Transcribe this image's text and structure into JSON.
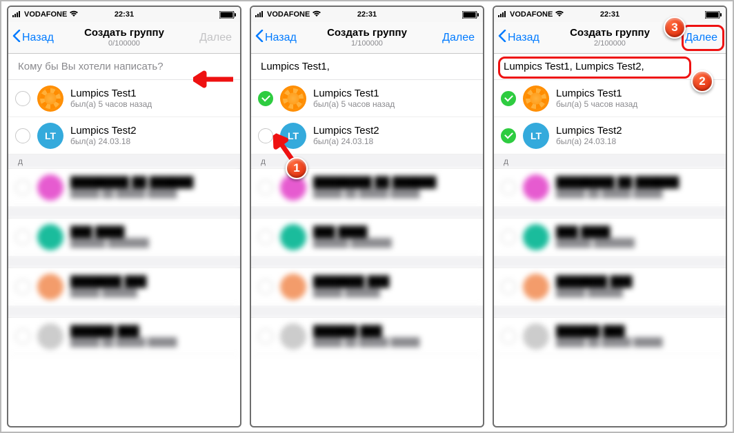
{
  "status": {
    "carrier": "VODAFONE",
    "time": "22:31"
  },
  "nav": {
    "back": "Назад",
    "title": "Создать группу",
    "next": "Далее"
  },
  "counters": {
    "p1": "0/100000",
    "p2": "1/100000",
    "p3": "2/100000"
  },
  "search": {
    "placeholder": "Кому бы Вы хотели написать?",
    "p2": "Lumpics Test1,",
    "p3": "Lumpics Test1,  Lumpics Test2,"
  },
  "contacts": {
    "c1": {
      "name": "Lumpics Test1",
      "status": "был(а) 5 часов назад"
    },
    "c2": {
      "name": "Lumpics Test2",
      "status": "был(а) 24.03.18",
      "initials": "LT"
    }
  },
  "sections": {
    "d": "д"
  },
  "callouts": {
    "n1": "1",
    "n2": "2",
    "n3": "3"
  }
}
